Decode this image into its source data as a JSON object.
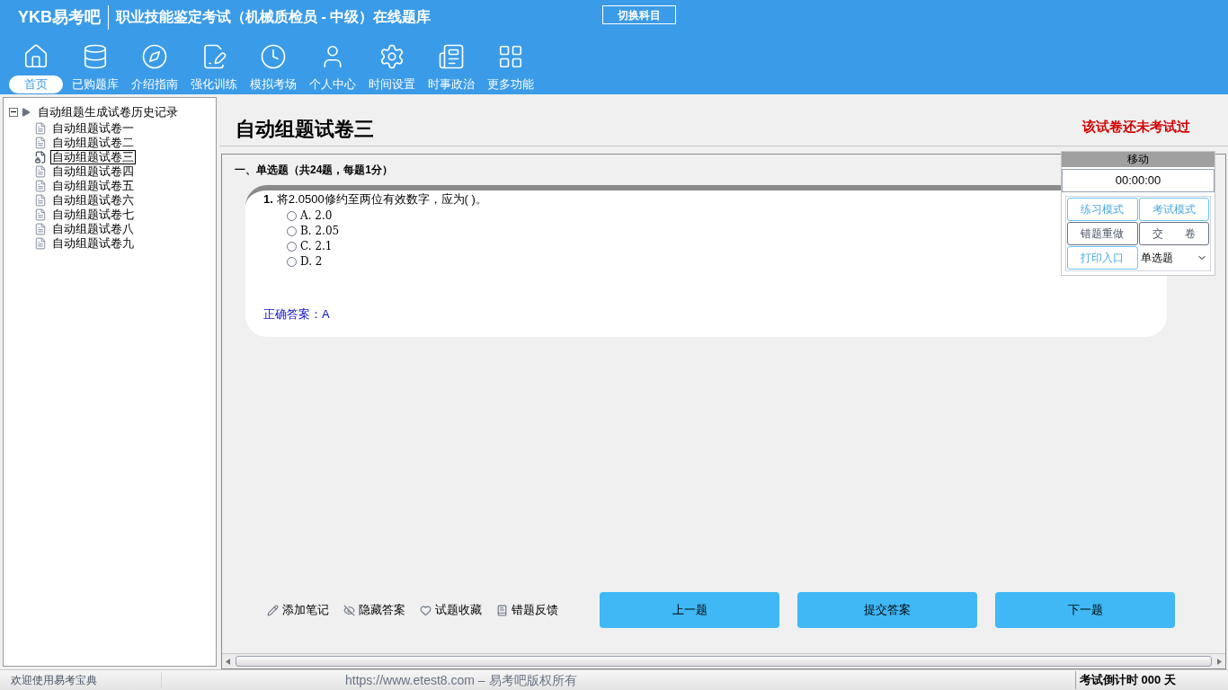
{
  "header": {
    "logo": "YKB易考吧",
    "title": "职业技能鉴定考试（机械质检员 - 中级）在线题库",
    "switch_button": "切换科目"
  },
  "nav": [
    {
      "label": "首页",
      "selected": true
    },
    {
      "label": "已购题库",
      "selected": false
    },
    {
      "label": "介绍指南",
      "selected": false
    },
    {
      "label": "强化训练",
      "selected": false
    },
    {
      "label": "模拟考场",
      "selected": false
    },
    {
      "label": "个人中心",
      "selected": false
    },
    {
      "label": "时间设置",
      "selected": false
    },
    {
      "label": "时事政治",
      "selected": false
    },
    {
      "label": "更多功能",
      "selected": false
    }
  ],
  "tree": {
    "label": "自动组题生成试卷历史记录",
    "expanded": true,
    "children": [
      {
        "label": "自动组题试卷一",
        "selected": false
      },
      {
        "label": "自动组题试卷二",
        "selected": false
      },
      {
        "label": "自动组题试卷三",
        "selected": true
      },
      {
        "label": "自动组题试卷四",
        "selected": false
      },
      {
        "label": "自动组题试卷五",
        "selected": false
      },
      {
        "label": "自动组题试卷六",
        "selected": false
      },
      {
        "label": "自动组题试卷七",
        "selected": false
      },
      {
        "label": "自动组题试卷八",
        "selected": false
      },
      {
        "label": "自动组题试卷九",
        "selected": false
      }
    ]
  },
  "paper": {
    "title": "自动组题试卷三",
    "status": "该试卷还未考试过"
  },
  "section": "一、单选题（共24题，每题1分）",
  "question": {
    "number": "1.",
    "text": "将2.0500修约至两位有效数字，应为( )。",
    "options": [
      {
        "label": "A. 2.0",
        "checked": false
      },
      {
        "label": "B. 2.05",
        "checked": false
      },
      {
        "label": "C. 2.1",
        "checked": false
      },
      {
        "label": "D. 2",
        "checked": false
      }
    ],
    "answer_label": "正确答案：",
    "answer": "A"
  },
  "tools": [
    "添加笔记",
    "隐藏答案",
    "试题收藏",
    "错题反馈"
  ],
  "nav_buttons": [
    "上一题",
    "提交答案",
    "下一题"
  ],
  "panel": {
    "title": "移动",
    "timer": "00:00:00",
    "buttons": [
      {
        "label": "练习模式",
        "kind": "blue"
      },
      {
        "label": "考试模式",
        "kind": "blue"
      },
      {
        "label": "错题重做",
        "kind": "gray"
      },
      {
        "label": "交　　卷",
        "kind": "gray"
      },
      {
        "label": "打印入口",
        "kind": "blue"
      }
    ],
    "select": "单选题"
  },
  "status_bar": {
    "welcome": "欢迎使用易考宝典",
    "copyright": "https://www.etest8.com – 易考吧版权所有",
    "countdown": "考试倒计时 000 天"
  }
}
